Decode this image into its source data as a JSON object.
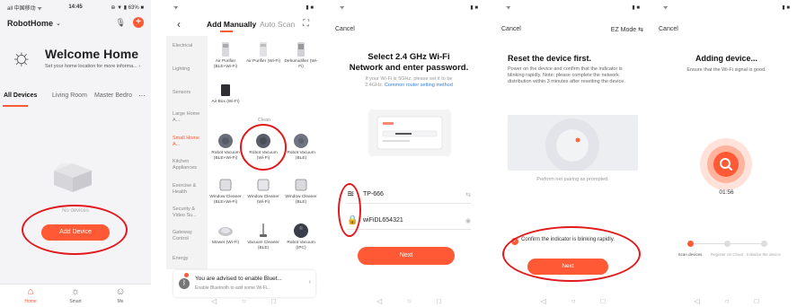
{
  "colors": {
    "accent": "#ff5a35",
    "annotation": "#e1191c",
    "link": "#2f7fdb"
  },
  "screen1": {
    "status": {
      "left": "all 中国移动 ᯤ",
      "time": "14:45",
      "right": "⊕ ▼ ▮ 63% ■"
    },
    "home_name": "RobotHome",
    "welcome": "Welcome Home",
    "location_hint": "Set your home location for more informa...",
    "tabs": [
      "All Devices",
      "Living Room",
      "Master Bedro"
    ],
    "empty_text": "No devices",
    "add_button": "Add Device",
    "tabbar": [
      "Home",
      "Smart",
      "Me"
    ]
  },
  "screen2": {
    "tab_manual": "Add Manually",
    "tab_auto": "Auto Scan",
    "categories": [
      "Electrical",
      "Lighting",
      "Sensors",
      "Large Home A...",
      "Small Home A...",
      "Kitchen Appliances",
      "Exercise & Health",
      "Security & Video Su...",
      "Gateway Control",
      "Energy"
    ],
    "row1": [
      "Air Purifier (BLE+Wi-Fi)",
      "Air Purifier (Wi-Fi)",
      "Dehumidifier (Wi-Fi)"
    ],
    "row2": [
      "Air Box (Wi-Fi)"
    ],
    "section_clean": "Clean",
    "row3": [
      "Robot Vacuum (BLE+Wi-Fi)",
      "Robot Vacuum (Wi-Fi)",
      "Robot Vacuum (BLE)"
    ],
    "row4": [
      "Window Cleaner (BLE+Wi-Fi)",
      "Window Cleaner (Wi-Fi)",
      "Window Cleaner (BLE)"
    ],
    "row5": [
      "Mower (Wi-Fi)",
      "Vacuum Cleaner (BLE)",
      "Robot Vacuum (IPC)"
    ],
    "bluetooth_title": "You are advised to enable Bluet...",
    "bluetooth_sub": "Enable Bluetooth to add some Wi-Fi..."
  },
  "screen3": {
    "cancel": "Cancel",
    "title_line1": "Select 2.4 GHz Wi-Fi",
    "title_line2": "Network and enter password.",
    "hint1": "If your Wi-Fi is 5GHz, please set it to be",
    "hint2": "2.4GHz.",
    "hint_link": "Common router setting method",
    "wifi_name": "TP-666",
    "password": "wiFiDL654321",
    "next": "Next"
  },
  "screen4": {
    "cancel": "Cancel",
    "mode": "EZ Mode ⇆",
    "title": "Reset the device first.",
    "desc": "Power on the device and confirm that the indicator is blinking rapidly. Note: please complete the network distribution within 3 minutes after resetting the device.",
    "pair_text": "Perform net pairing as prompted.",
    "confirm": "Confirm the indicator is blinking rapidly.",
    "next": "Next"
  },
  "screen5": {
    "cancel": "Cancel",
    "title": "Adding device...",
    "desc": "Ensure that the Wi-Fi signal is good.",
    "timer": "01:56",
    "steps": [
      "Scan devices",
      "Register on Cloud",
      "Initialize the device"
    ]
  }
}
